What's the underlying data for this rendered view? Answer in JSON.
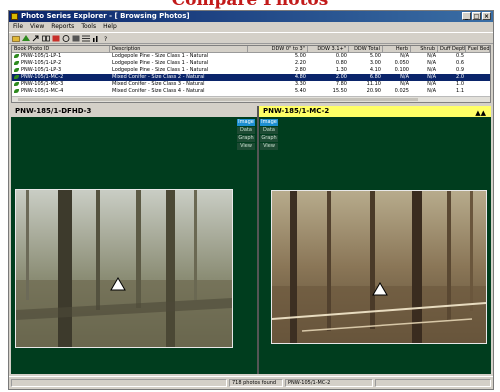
{
  "page_heading": "Compare Photos",
  "window": {
    "title": "Photo Series Explorer - [ Browsing Photos]",
    "controls": [
      "_",
      "□",
      "×"
    ]
  },
  "menu": [
    "File",
    "View",
    "Reports",
    "Tools",
    "Help"
  ],
  "toolbar_icons": [
    "folder-icon",
    "tree-icon",
    "arrow-icon",
    "compare-icon",
    "photo-icon",
    "globe-icon",
    "grid-icon",
    "list-icon",
    "chart-icon",
    "help-icon"
  ],
  "table": {
    "columns": [
      "Book Photo ID",
      "Description",
      "DDW 0\" to 3\"",
      "DDW 3.1+\"",
      "DDW Total",
      "Herb",
      "Shrub",
      "Duff Depth",
      "Fuel Bed"
    ],
    "rows": [
      [
        "PNW-105/1-LP-1",
        "Lodgepole Pine - Size Class 1 - Natural",
        "5.00",
        "0.00",
        "5.00",
        "N/A",
        "N/A",
        "0.5",
        ""
      ],
      [
        "PNW-105/1-LP-2",
        "Lodgepole Pine - Size Class 1 - Natural",
        "2.20",
        "0.80",
        "3.00",
        "0.050",
        "N/A",
        "0.6",
        ""
      ],
      [
        "PNW-105/1-LP-3",
        "Lodgepole Pine - Size Class 1 - Natural",
        "2.80",
        "1.30",
        "4.10",
        "0.100",
        "N/A",
        "0.9",
        ""
      ],
      [
        "PNW-105/1-MC-2",
        "Mixed Conifer - Size Class 2 - Natural",
        "4.80",
        "2.00",
        "6.80",
        "N/A",
        "N/A",
        "2.0",
        ""
      ],
      [
        "PNW-105/1-MC-3",
        "Mixed Conifer - Size Class 3 - Natural",
        "3.30",
        "7.80",
        "11.10",
        "N/A",
        "N/A",
        "1.0",
        ""
      ],
      [
        "PNW-105/1-MC-4",
        "Mixed Conifer - Size Class 4 - Natural",
        "5.40",
        "15.50",
        "20.90",
        "0.025",
        "N/A",
        "1.1",
        ""
      ]
    ],
    "selected_row": 3
  },
  "left_pane": {
    "title": "PNW-185/1-DFHD-3",
    "buttons": [
      "Image",
      "Data",
      "Graph",
      "View"
    ],
    "active": "Image"
  },
  "right_pane": {
    "title": "PNW-185/1-MC-2",
    "buttons": [
      "Image",
      "Data",
      "Graph",
      "View"
    ],
    "active": "Image"
  },
  "status": {
    "photos_found": "718 photos found",
    "selected": "PNW-105/1-MC-2"
  },
  "colors": {
    "heading": "#c21a1a",
    "selection": "#0a246a",
    "pane_bg": "#003d1e",
    "right_header": "#ffff66",
    "active_button": "#1d8fd1"
  }
}
